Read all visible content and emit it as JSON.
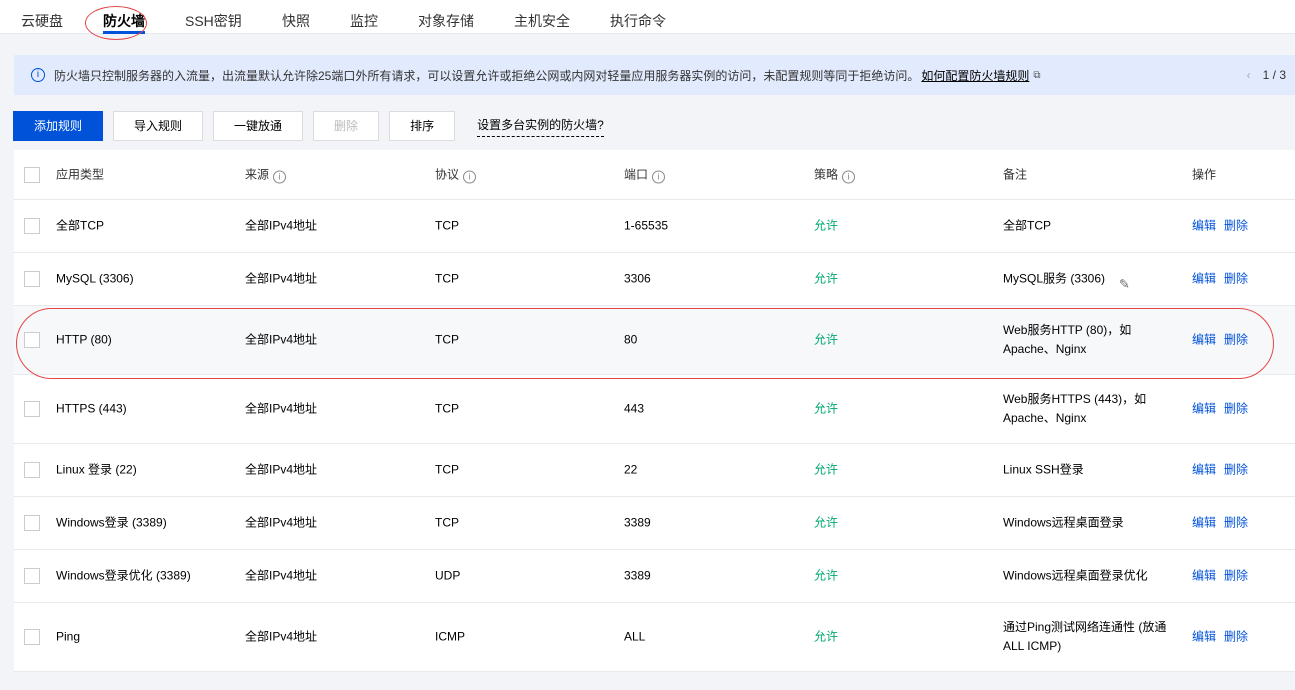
{
  "tabs": [
    "云硬盘",
    "防火墙",
    "SSH密钥",
    "快照",
    "监控",
    "对象存储",
    "主机安全",
    "执行命令"
  ],
  "active_tab": "防火墙",
  "notice": {
    "text": "防火墙只控制服务器的入流量，出流量默认允许除25端口外所有请求，可以设置允许或拒绝公网或内网对轻量应用服务器实例的访问，未配置规则等同于拒绝访问。",
    "link": "如何配置防火墙规则",
    "pager": "1 / 3"
  },
  "toolbar": {
    "add": "添加规则",
    "import": "导入规则",
    "open_all": "一键放通",
    "delete": "删除",
    "sort": "排序",
    "help": "设置多台实例的防火墙?"
  },
  "columns": [
    "应用类型",
    "来源",
    "协议",
    "端口",
    "策略",
    "备注",
    "操作"
  ],
  "actions": {
    "edit": "编辑",
    "delete": "删除"
  },
  "rows": [
    {
      "type": "全部TCP",
      "source": "全部IPv4地址",
      "protocol": "TCP",
      "port": "1-65535",
      "policy": "允许",
      "note": "全部TCP"
    },
    {
      "type": "MySQL (3306)",
      "source": "全部IPv4地址",
      "protocol": "TCP",
      "port": "3306",
      "policy": "允许",
      "note": "MySQL服务 (3306)"
    },
    {
      "type": "HTTP (80)",
      "source": "全部IPv4地址",
      "protocol": "TCP",
      "port": "80",
      "policy": "允许",
      "note": "Web服务HTTP (80)，如 Apache、Nginx"
    },
    {
      "type": "HTTPS (443)",
      "source": "全部IPv4地址",
      "protocol": "TCP",
      "port": "443",
      "policy": "允许",
      "note": "Web服务HTTPS (443)，如 Apache、Nginx"
    },
    {
      "type": "Linux 登录 (22)",
      "source": "全部IPv4地址",
      "protocol": "TCP",
      "port": "22",
      "policy": "允许",
      "note": "Linux SSH登录"
    },
    {
      "type": "Windows登录 (3389)",
      "source": "全部IPv4地址",
      "protocol": "TCP",
      "port": "3389",
      "policy": "允许",
      "note": "Windows远程桌面登录"
    },
    {
      "type": "Windows登录优化 (3389)",
      "source": "全部IPv4地址",
      "protocol": "UDP",
      "port": "3389",
      "policy": "允许",
      "note": "Windows远程桌面登录优化"
    },
    {
      "type": "Ping",
      "source": "全部IPv4地址",
      "protocol": "ICMP",
      "port": "ALL",
      "policy": "允许",
      "note": "通过Ping测试网络连通性 (放通 ALL ICMP)"
    }
  ]
}
